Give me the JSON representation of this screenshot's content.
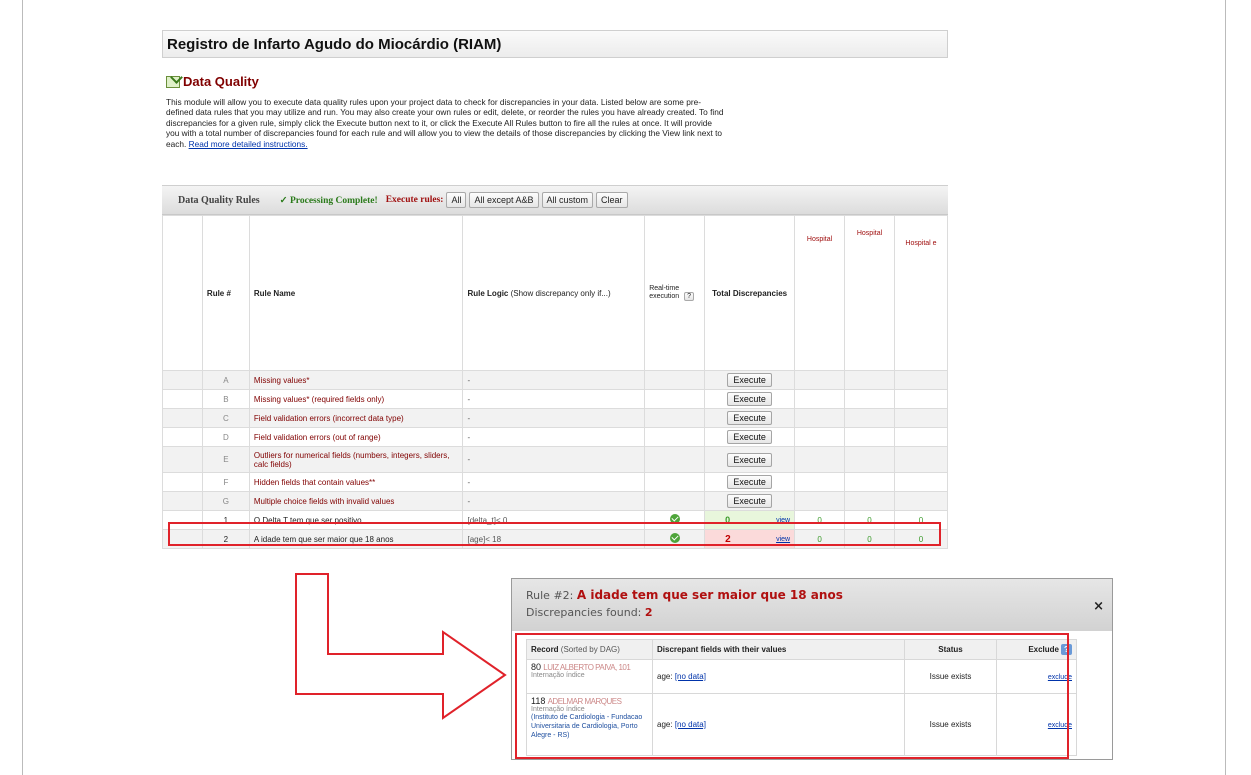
{
  "project_title": "Registro de Infarto Agudo do Miocárdio (RIAM)",
  "module_title": "Data Quality",
  "intro": {
    "text": "This module will allow you to execute data quality rules upon your project data to check for discrepancies in your data. Listed below are some pre-defined data rules that you may utilize and run. You may also create your own rules or edit, delete, or reorder the rules you have already created. To find discrepancies for a given rule, simply click the Execute button next to it, or click the Execute All Rules button to fire all the rules at once. It will provide you with a total number of discrepancies found for each rule and will allow you to view the details of those discrepancies by clicking the View link next to each.",
    "link": "Read more detailed instructions."
  },
  "rules_bar": {
    "label": "Data Quality Rules",
    "status": "✓ Processing Complete!",
    "execute_label": "Execute rules:",
    "buttons": [
      "All",
      "All except A&B",
      "All custom",
      "Clear"
    ]
  },
  "table_headers": {
    "rule_num": "Rule #",
    "rule_name": "Rule Name",
    "rule_logic": "Rule Logic",
    "rule_logic_sub": "(Show discrepancy only if...)",
    "realtime": "Real-time execution",
    "realtime_help": "?",
    "total": "Total Discrepancies",
    "hosp1": "Hospital",
    "hosp2": "Hospital",
    "hosp3": "Hospital e"
  },
  "rules": [
    {
      "num": "A",
      "name": "Missing values*",
      "logic": "-",
      "action": "Execute"
    },
    {
      "num": "B",
      "name": "Missing values* (required fields only)",
      "logic": "-",
      "action": "Execute"
    },
    {
      "num": "C",
      "name": "Field validation errors (incorrect data type)",
      "logic": "-",
      "action": "Execute"
    },
    {
      "num": "D",
      "name": "Field validation errors (out of range)",
      "logic": "-",
      "action": "Execute"
    },
    {
      "num": "E",
      "name": "Outliers for numerical fields (numbers, integers, sliders, calc fields)",
      "logic": "-",
      "action": "Execute"
    },
    {
      "num": "F",
      "name": "Hidden fields that contain values**",
      "logic": "-",
      "action": "Execute"
    },
    {
      "num": "G",
      "name": "Multiple choice fields with invalid values",
      "logic": "-",
      "action": "Execute"
    },
    {
      "num": "1",
      "name": "O Delta T tem que ser positivo.",
      "logic": "[delta_t]< 0",
      "total": "0",
      "view": "view",
      "h1": "0",
      "h2": "0",
      "h3": "0"
    },
    {
      "num": "2",
      "name": "A idade tem que ser maior que 18 anos",
      "logic": "[age]< 18",
      "total": "2",
      "view": "view",
      "h1": "0",
      "h2": "0",
      "h3": "0"
    }
  ],
  "popup": {
    "rule_prefix": "Rule #2:",
    "rule_title": "A idade tem que ser maior que 18 anos",
    "found_label": "Discrepancies found:",
    "found_count": "2",
    "close": "×",
    "headers": {
      "record": "Record",
      "record_sub": "(Sorted by DAG)",
      "fields": "Discrepant fields with their values",
      "status": "Status",
      "exclude": "Exclude"
    },
    "rows": [
      {
        "id": "80",
        "name_blur": "LUIZ ALBERTO PAIVA, 101",
        "sub": "Internação índice",
        "field": "age:",
        "value": "[no data]",
        "status": "Issue exists",
        "exclude": "exclude"
      },
      {
        "id": "118",
        "name_blur": "ADELMAR MARQUES",
        "sub": "Internação índice",
        "dag": "(Instituto de Cardiologia - Fundacao Universitaria de Cardiologia, Porto Alegre - RS)",
        "field": "age:",
        "value": "[no data]",
        "status": "Issue exists",
        "exclude": "exclude"
      }
    ]
  },
  "colors": {
    "accent_red": "#e0222a",
    "title_maroon": "#800000",
    "ok_green": "#4ea53a"
  }
}
